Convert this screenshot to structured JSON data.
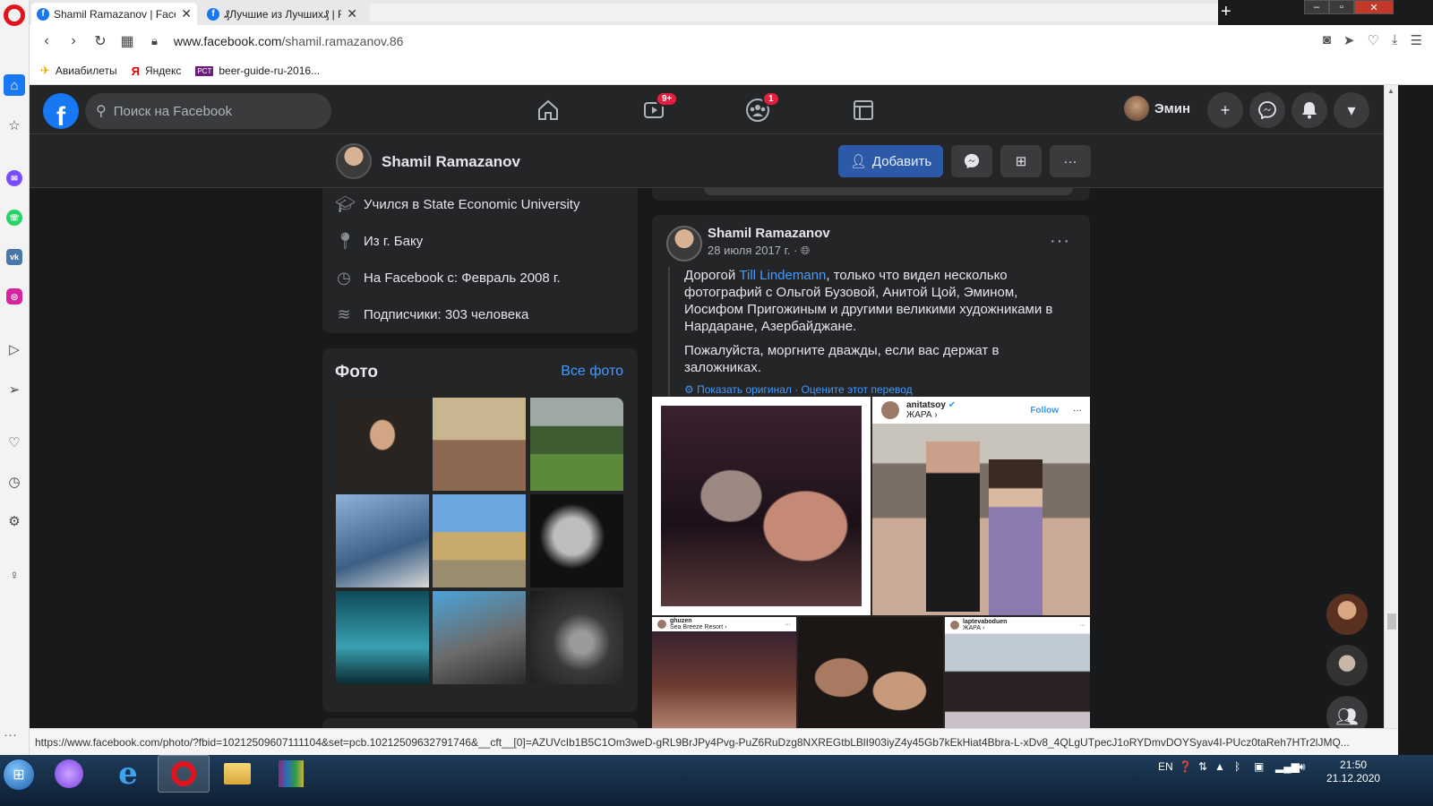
{
  "browser": {
    "tabs": [
      {
        "title": "Shamil Ramazanov | Faceb",
        "active": true
      },
      {
        "title": "₰Лучшие из Лучших₰ | F",
        "active": false
      }
    ],
    "url_domain": "www.facebook.com",
    "url_path": "/shamil.ramazanov.86",
    "bookmarks": [
      {
        "label": "Авиабилеты",
        "icon": "plane-icon"
      },
      {
        "label": "Яндекс",
        "icon": "yandex-icon"
      },
      {
        "label": "beer-guide-ru-2016...",
        "icon": "pct-icon"
      }
    ],
    "status_url": "https://www.facebook.com/photo/?fbid=10212509607111104&set=pcb.10212509632791746&__cft__[0]=AZUVcIb1B5C1Om3weD-gRL9BrJPy4Pvg-PuZ6RuDzg8NXREGtbLBlI903iyZ4y45Gb7kEkHiat4Bbra-L-xDv8_4QLgUTpecJ1oRYDmvDOYSyav4I-PUcz0taReh7HTr2lJMQ..."
  },
  "fb_nav": {
    "search_placeholder": "Поиск на Facebook",
    "watch_badge": "9+",
    "groups_badge": "1",
    "user_name": "Эмин"
  },
  "profile": {
    "name": "Shamil Ramazanov",
    "add_friend_label": "Добавить"
  },
  "intro": {
    "items": [
      {
        "icon": "education-icon",
        "text": "Учился в State Economic University"
      },
      {
        "icon": "location-icon",
        "text": "Из г. Баку"
      },
      {
        "icon": "clock-icon",
        "text": "На Facebook с: Февраль 2008 г."
      },
      {
        "icon": "followers-icon",
        "text": "Подписчики: 303 человека"
      }
    ]
  },
  "photos": {
    "title": "Фото",
    "see_all": "Все фото"
  },
  "post": {
    "author": "Shamil Ramazanov",
    "date": "28 июля 2017 г. · ",
    "text_before_link": "Дорогой ",
    "link": "Till Lindemann",
    "text_after_link": ", только что видел несколько фотографий с Ольгой Бузовой, Анитой Цой, Эмином, Иосифом Пригожиным и другими великими художниками в Нардаране, Азербайджане.",
    "text_2": "Пожалуйста, моргните дважды, если вас держат в заложниках.",
    "translate_show": "Показать оригинал",
    "translate_rate": "Оцените этот перевод",
    "insta_user": "anitatsoy",
    "insta_sub": "ЖАРА ›",
    "insta_follow": "Follow",
    "insta_user_2": "ghuzen",
    "insta_sub_2": "Sea Breeze Resort ›",
    "insta_user_3": "laptevaboduen",
    "insta_sub_3": "ЖАРА ›"
  },
  "taskbar": {
    "lang": "EN",
    "time": "21:50",
    "date": "21.12.2020"
  }
}
